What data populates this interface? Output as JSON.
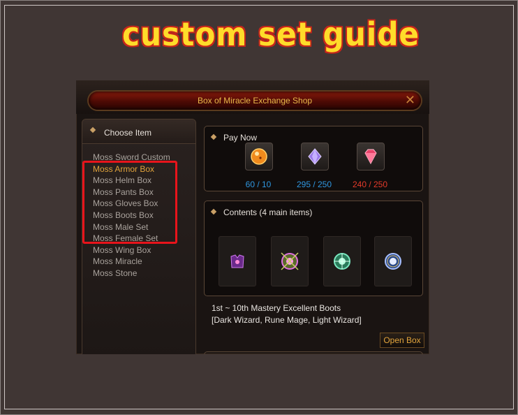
{
  "guide_title": "custom set guide",
  "window": {
    "title": "Box of Miracle Exchange Shop",
    "close_glyph": "✕"
  },
  "choose_item": {
    "heading": "Choose Item",
    "items": [
      {
        "label": "Moss Sword Custom",
        "active": false
      },
      {
        "label": "Moss Armor Box",
        "active": true
      },
      {
        "label": "Moss Helm Box",
        "active": false
      },
      {
        "label": "Moss Pants Box",
        "active": false
      },
      {
        "label": "Moss Gloves Box",
        "active": false
      },
      {
        "label": "Moss Boots Box",
        "active": false
      },
      {
        "label": "Moss Male Set",
        "active": false
      },
      {
        "label": "Moss Female Set",
        "active": false
      },
      {
        "label": "Moss Wing Box",
        "active": false
      },
      {
        "label": "Moss Miracle",
        "active": false
      },
      {
        "label": "Moss Stone",
        "active": false
      }
    ]
  },
  "pay_now": {
    "heading": "Pay Now",
    "costs": [
      {
        "icon": "orange-orb-icon",
        "value": "60 / 10",
        "color": "#2f97e0"
      },
      {
        "icon": "purple-gem-icon",
        "value": "295 / 250",
        "color": "#2f97e0"
      },
      {
        "icon": "red-gem-icon",
        "value": "240 / 250",
        "color": "#e43a2a"
      }
    ]
  },
  "contents": {
    "heading": "Contents (4 main items)",
    "items": [
      "purple-boots-icon",
      "pink-jewel-icon",
      "green-jewel-icon",
      "blue-jewel-icon"
    ]
  },
  "description": {
    "line1": "1st ~ 10th Mastery Excellent Boots",
    "line2": "[Dark Wizard, Rune Mage, Light Wizard]"
  },
  "open_box_label": "Open Box",
  "colors": {
    "accent_gold": "#e2a43c",
    "highlight_red": "#e8141b"
  }
}
